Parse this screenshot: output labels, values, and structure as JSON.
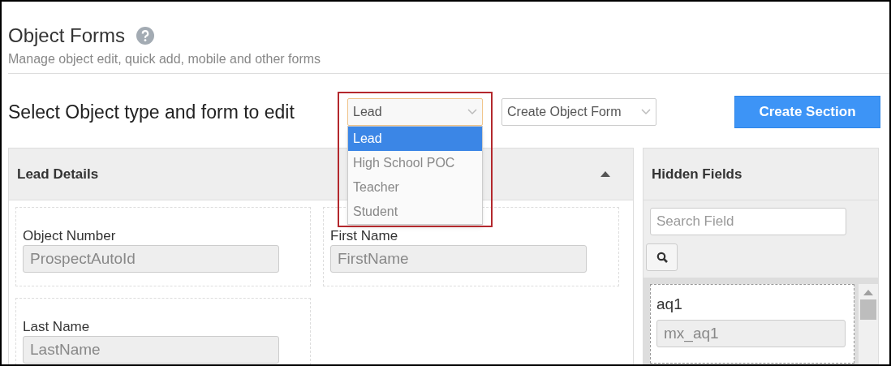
{
  "header": {
    "title": "Object Forms",
    "subtitle": "Manage object edit, quick add, mobile and other forms"
  },
  "toolbar": {
    "label": "Select Object type and form to edit",
    "object_type": {
      "value": "Lead",
      "expanded": true,
      "options": [
        {
          "label": "Lead",
          "selected": true
        },
        {
          "label": "High School POC",
          "selected": false
        },
        {
          "label": "Teacher",
          "selected": false
        },
        {
          "label": "Student",
          "selected": false
        }
      ]
    },
    "object_form": {
      "value": "Create Object Form"
    },
    "create_button": "Create Section"
  },
  "section": {
    "title": "Lead Details",
    "expanded": true,
    "fields": [
      {
        "label": "Object Number",
        "value": "ProspectAutoId",
        "disabled": true
      },
      {
        "label": "First Name",
        "value": "FirstName",
        "disabled": true
      },
      {
        "label": "Last Name",
        "value": "LastName",
        "disabled": true
      }
    ]
  },
  "hidden_fields": {
    "title": "Hidden Fields",
    "search": {
      "placeholder": "Search Field"
    },
    "fields": [
      {
        "label": "aq1",
        "value": "mx_aq1",
        "disabled": true
      }
    ]
  }
}
